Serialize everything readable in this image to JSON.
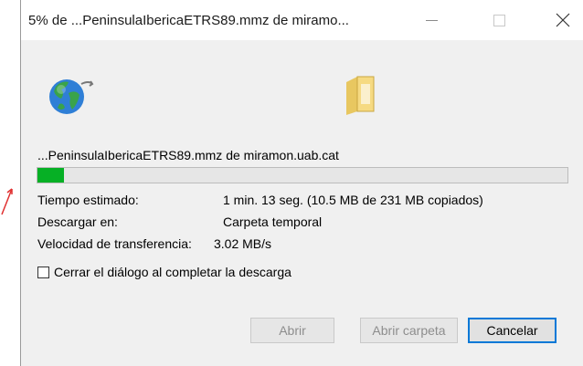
{
  "window": {
    "title": "5% de ...PeninsulaIbericaETRS89.mmz de miramo...",
    "minimize_icon": "minimize-icon",
    "maximize_icon": "maximize-icon",
    "close_icon": "close-icon"
  },
  "icons": {
    "source": "globe-icon",
    "destination": "folder-icon"
  },
  "download": {
    "file_line": "...PeninsulaIbericaETRS89.mmz de miramon.uab.cat",
    "progress_fraction": 0.05,
    "progress_color": "#06b025"
  },
  "info": {
    "time_label": "Tiempo estimado:",
    "time_value": "1 min. 13 seg. (10.5 MB de 231 MB copiados)",
    "location_label": "Descargar en:",
    "location_value": "Carpeta temporal",
    "speed_label": "Velocidad de transferencia:",
    "speed_value": "3.02 MB/s"
  },
  "checkbox": {
    "label": "Cerrar el diálogo al completar la descarga",
    "checked": false
  },
  "buttons": {
    "open": "Abrir",
    "open_folder": "Abrir carpeta",
    "cancel": "Cancelar"
  },
  "colors": {
    "accent": "#0078d7",
    "annotation": "#e03030"
  }
}
